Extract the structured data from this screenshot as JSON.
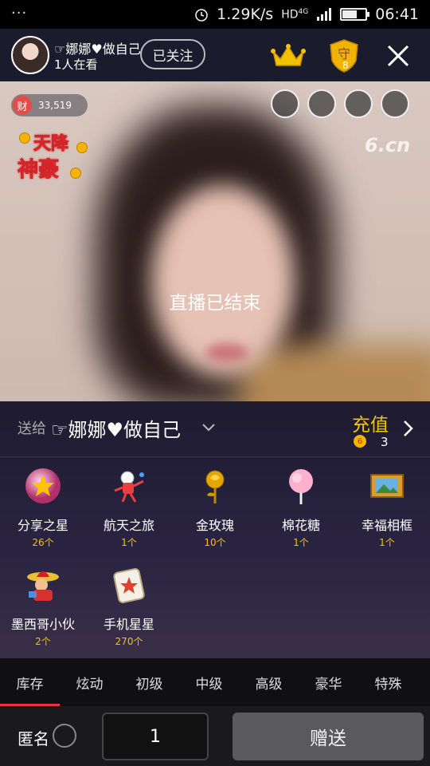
{
  "status_bar": {
    "menu_dots": "···",
    "speed": "1.29K/s",
    "network": "HD",
    "signal_type": "4G",
    "time": "06:41"
  },
  "header": {
    "host_name": "☞娜娜♥做自己",
    "viewers": "1人在看",
    "follow_label": "已关注",
    "guard_count": "8",
    "guard_icon_text": "守"
  },
  "video": {
    "wealth_icon_text": "财",
    "wealth_value": "33,519",
    "promo_line1": "天降",
    "promo_line2": "神豪",
    "watermark": "6.cn",
    "ended_text": "直播已结束"
  },
  "gift_panel": {
    "send_to_label": "送给",
    "recipient": "☞娜娜♥做自己",
    "recharge_label": "充值",
    "balance": "3",
    "balance_coin_text": "6",
    "gifts": [
      {
        "name": "分享之星",
        "count": "26个",
        "icon": "star-orb-icon"
      },
      {
        "name": "航天之旅",
        "count": "1个",
        "icon": "astronaut-icon"
      },
      {
        "name": "金玫瑰",
        "count": "10个",
        "icon": "gold-rose-icon"
      },
      {
        "name": "棉花糖",
        "count": "1个",
        "icon": "cotton-candy-icon"
      },
      {
        "name": "幸福相框",
        "count": "1个",
        "icon": "photo-frame-icon"
      },
      {
        "name": "墨西哥小伙",
        "count": "2个",
        "icon": "mexican-guy-icon"
      },
      {
        "name": "手机星星",
        "count": "270个",
        "icon": "phone-star-icon"
      }
    ]
  },
  "tabs": [
    "库存",
    "炫动",
    "初级",
    "中级",
    "高级",
    "豪华",
    "特殊"
  ],
  "bottom_bar": {
    "anonymous_label": "匿名",
    "quantity": "1",
    "send_label": "赠送"
  },
  "colors": {
    "accent_yellow": "#f5c400",
    "tab_indicator": "#e8343c",
    "send_button": "#5a5a5e"
  }
}
